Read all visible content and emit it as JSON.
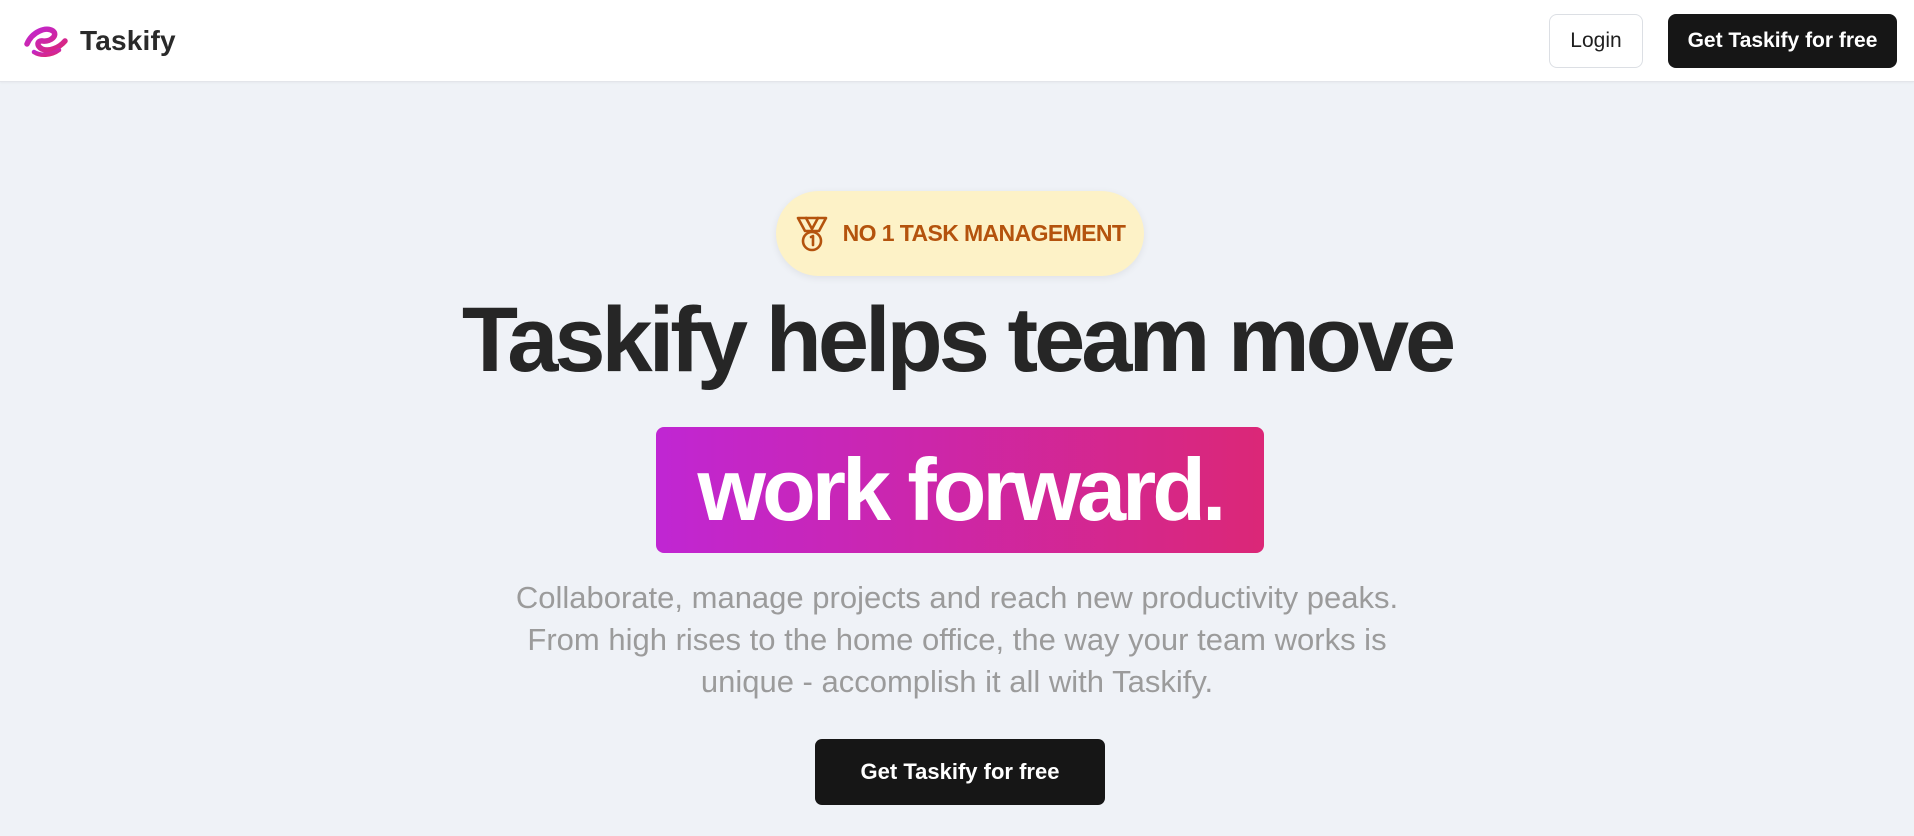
{
  "colors": {
    "page_background": "#eff2f7",
    "brand_accent_start": "#c026d3",
    "brand_accent_end": "#db2777",
    "badge_background": "#fdf2c7",
    "badge_text": "#b4530d",
    "button_dark": "#161616"
  },
  "header": {
    "brand_name": "Taskify",
    "logo_icon": "taskify-logo-icon",
    "login_label": "Login",
    "cta_label": "Get Taskify for free"
  },
  "hero": {
    "badge_icon": "medal-icon",
    "badge_text": "NO 1 TASK MANAGEMENT",
    "headline": "Taskify helps team move",
    "highlight": "work forward.",
    "subtext_lines": [
      "Collaborate, manage projects and reach new productivity peaks.",
      "From high rises to the home office, the way your team works is",
      "unique - accomplish it all with Taskify."
    ],
    "cta_label": "Get Taskify for free"
  }
}
